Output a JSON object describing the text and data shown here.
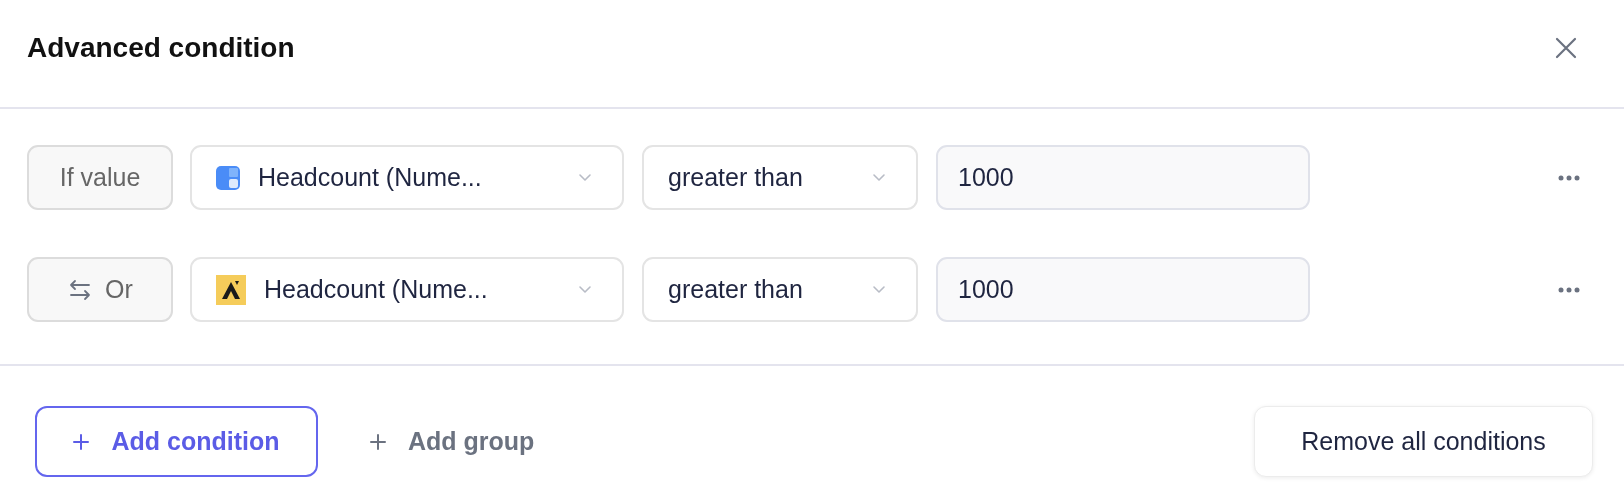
{
  "dialog": {
    "title": "Advanced condition"
  },
  "conditions": [
    {
      "connector": {
        "kind": "if",
        "label": "If value"
      },
      "field": {
        "kind": "tile",
        "label": "Headcount (Nume..."
      },
      "operator": "greater than",
      "value": "1000"
    },
    {
      "connector": {
        "kind": "or",
        "label": "Or"
      },
      "field": {
        "kind": "logo",
        "label": "Headcount (Nume..."
      },
      "operator": "greater than",
      "value": "1000"
    }
  ],
  "footer": {
    "add_condition": "Add condition",
    "add_group": "Add group",
    "remove_all": "Remove all conditions"
  }
}
